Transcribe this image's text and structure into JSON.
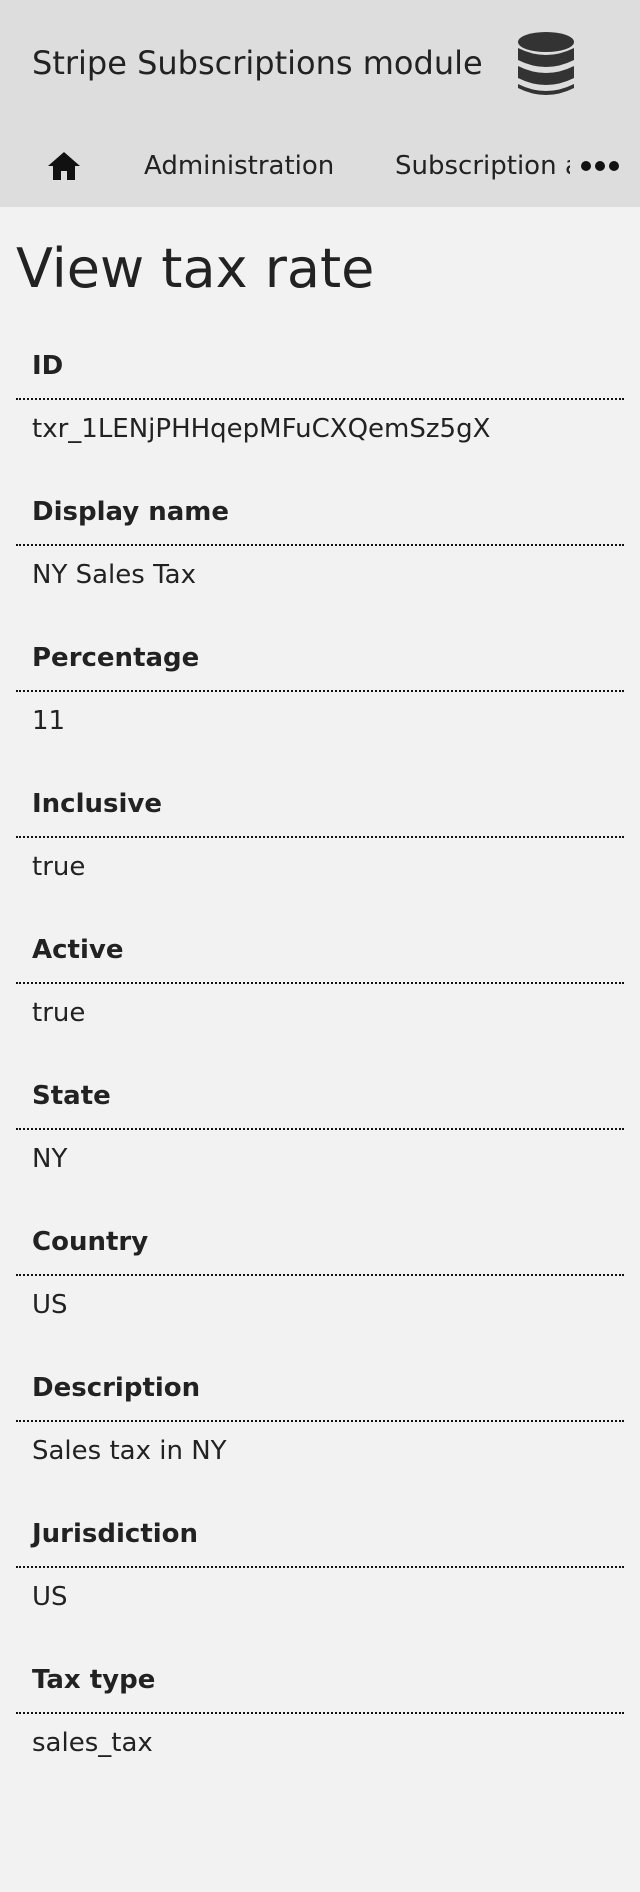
{
  "header": {
    "site_title": "Stripe Subscriptions module",
    "logo_icon": "database-icon"
  },
  "nav": {
    "home_icon": "home-icon",
    "items": [
      {
        "label": "Administration"
      },
      {
        "label": "Subscription and Tax rates"
      }
    ],
    "more_icon": "more-horizontal-icon"
  },
  "page": {
    "title": "View tax rate"
  },
  "fields": [
    {
      "label": "ID",
      "value": "txr_1LENjPHHqepMFuCXQemSz5gX"
    },
    {
      "label": "Display name",
      "value": "NY Sales Tax"
    },
    {
      "label": "Percentage",
      "value": "11"
    },
    {
      "label": "Inclusive",
      "value": "true"
    },
    {
      "label": "Active",
      "value": "true"
    },
    {
      "label": "State",
      "value": "NY"
    },
    {
      "label": "Country",
      "value": "US"
    },
    {
      "label": "Description",
      "value": "Sales tax in NY"
    },
    {
      "label": "Jurisdiction",
      "value": "US"
    },
    {
      "label": "Tax type",
      "value": "sales_tax"
    }
  ],
  "colors": {
    "header_bg": "#dddddd",
    "page_bg": "#f2f2f2",
    "text": "#222222",
    "icon": "#333333"
  }
}
